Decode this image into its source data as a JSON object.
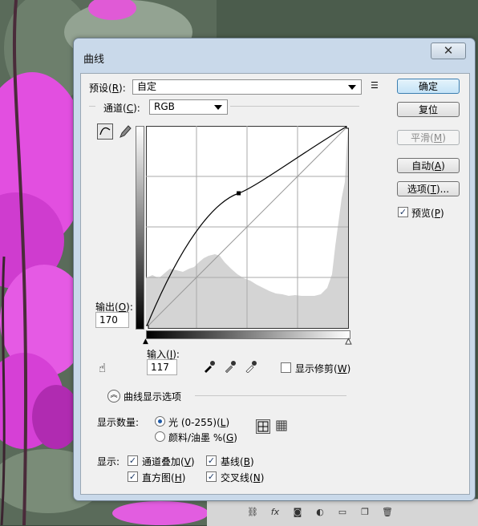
{
  "dialog": {
    "title": "曲线",
    "close_symbol": "✕",
    "preset": {
      "label": "预设",
      "key": "R",
      "value": "自定"
    },
    "channel": {
      "label": "通道",
      "key": "C",
      "value": "RGB"
    },
    "output": {
      "label": "输出",
      "key": "O",
      "value": "170"
    },
    "input": {
      "label": "输入",
      "key": "I",
      "value": "117"
    },
    "show_clipping": {
      "label": "显示修剪",
      "key": "W",
      "checked": false
    },
    "curve_display_options": "曲线显示选项",
    "show_amount": {
      "label": "显示数量:",
      "light": {
        "label": "光 (0-255)",
        "key": "L",
        "selected": true
      },
      "pigment": {
        "label": "颜料/油墨 %",
        "key": "G",
        "selected": false
      }
    },
    "show": {
      "label": "显示:",
      "channel_overlays": {
        "label": "通道叠加",
        "key": "V",
        "checked": true
      },
      "baseline": {
        "label": "基线",
        "key": "B",
        "checked": true
      },
      "histogram": {
        "label": "直方图",
        "key": "H",
        "checked": true
      },
      "intersection_line": {
        "label": "交叉线",
        "key": "N",
        "checked": true
      }
    },
    "buttons": {
      "ok": "确定",
      "reset": "复位",
      "smooth": {
        "label": "平滑",
        "key": "M"
      },
      "auto": {
        "label": "自动",
        "key": "A"
      },
      "options": {
        "label": "选项",
        "key": "T",
        "suffix": "..."
      }
    },
    "preview": {
      "label": "预览",
      "key": "P",
      "checked": true
    },
    "curve": {
      "input": 117,
      "output": 170
    }
  },
  "icons": {
    "menu": "menu-icon",
    "curve_tool": "curve-edit-icon",
    "pencil": "pencil-icon",
    "hand": "target-adjust-icon",
    "eyedroppers": [
      "black-eyedropper-icon",
      "gray-eyedropper-icon",
      "white-eyedropper-icon"
    ],
    "grid_simple": "grid-4x4-icon",
    "grid_detail": "grid-10x10-icon"
  },
  "taskbar": {
    "icons": [
      "link-icon",
      "fx-icon",
      "mask-icon",
      "adjustment-icon",
      "folder-icon",
      "new-layer-icon",
      "trash-icon"
    ]
  },
  "colors": {
    "orchid": "#d83ad8",
    "leaf": "#56725a",
    "accent": "#1e5aa8"
  }
}
